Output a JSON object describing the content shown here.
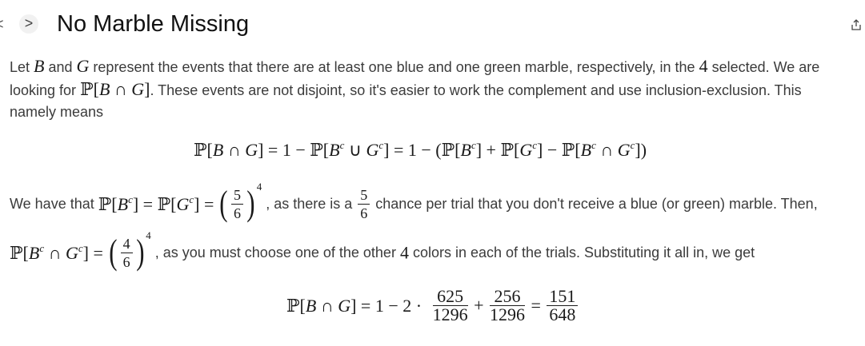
{
  "nav": {
    "back": "<",
    "forward": ">"
  },
  "header": {
    "title": "No Marble Missing"
  },
  "para1": {
    "line1_a": "Let ",
    "B": "B",
    "line1_b": " and ",
    "G": "G",
    "line1_c": " represent the events that there are at least one blue and one green marble, respectively, in the ",
    "four": "4",
    "line1_d": " selected. We are",
    "line2_a": "looking for ",
    "line2_b": ". These events are not disjoint, so it's easier to work the complement and use inclusion-exclusion. This",
    "line3": "namely means"
  },
  "eq1": "ℙ[B ∩ G] = 1 − ℙ[Bᶜ ∪ Gᶜ] = 1 − (ℙ[Bᶜ] + ℙ[Gᶜ] − ℙ[Bᶜ ∩ Gᶜ])",
  "para2": {
    "a": "We have that ",
    "b": ", as there is a ",
    "c": " chance per trial that you don't receive a blue (or green) marble. Then,",
    "d": ", as you must choose one of the other ",
    "e": "4",
    "f": " colors in each of the trials. Substituting it all in, we get"
  },
  "fractions": {
    "five": "5",
    "six": "6",
    "four": "4",
    "exp": "4",
    "n625": "625",
    "n256": "256",
    "n151": "151",
    "d1296": "1296",
    "d648": "648"
  },
  "eq2": {
    "lhs": "ℙ[B ∩ G] = 1 − 2 ·",
    "plus": "+",
    "eq": "="
  }
}
